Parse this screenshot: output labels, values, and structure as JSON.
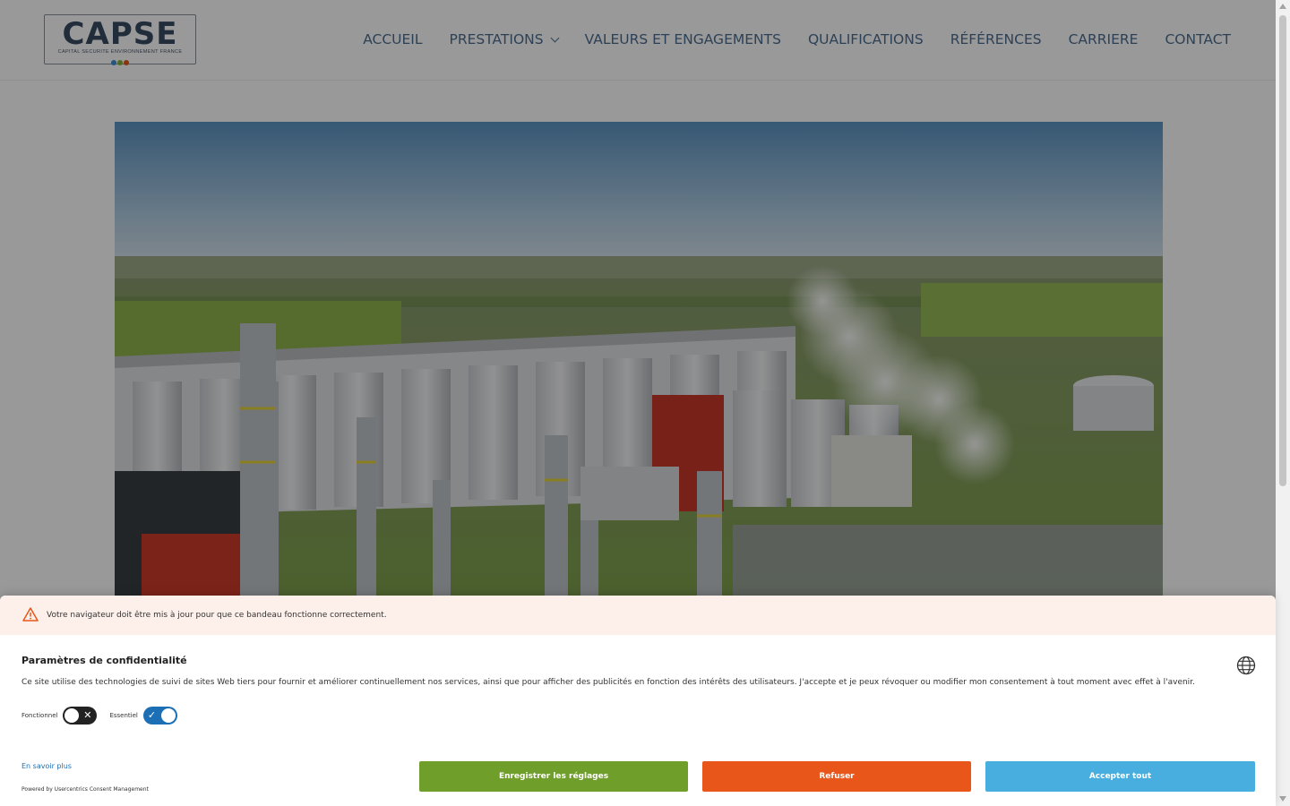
{
  "header": {
    "logo": {
      "wordmark": "CAPSE",
      "tagline": "CAPITAL SECURITE ENVIRONNEMENT FRANCE",
      "dot_colors": [
        "#3b8fd4",
        "#7fb539",
        "#e8561a"
      ]
    },
    "nav": [
      {
        "label": "ACCUEIL",
        "has_dropdown": false
      },
      {
        "label": "PRESTATIONS",
        "has_dropdown": true
      },
      {
        "label": "VALEURS ET ENGAGEMENTS",
        "has_dropdown": false
      },
      {
        "label": "QUALIFICATIONS",
        "has_dropdown": false
      },
      {
        "label": "RÉFÉRENCES",
        "has_dropdown": false
      },
      {
        "label": "CARRIERE",
        "has_dropdown": false
      },
      {
        "label": "CONTACT",
        "has_dropdown": false
      }
    ]
  },
  "hero": {
    "image_subject": "aerial view of industrial plant with grain silos, distillation columns and steam plumes over farmland"
  },
  "consent": {
    "warning": {
      "icon": "warning-triangle-icon",
      "text": "Votre navigateur doit être mis à jour pour que ce bandeau fonctionne correctement."
    },
    "title": "Paramètres de confidentialité",
    "language_icon": "globe-icon",
    "description": "Ce site utilise des technologies de suivi de sites Web tiers pour fournir et améliorer continuellement nos services, ainsi que pour afficher des publicités en fonction des intérêts des utilisateurs. J'accepte et je peux révoquer ou modifier mon consentement à tout moment avec effet à l'avenir.",
    "toggles": [
      {
        "label": "Fonctionnel",
        "state": "off"
      },
      {
        "label": "Essentiel",
        "state": "on"
      }
    ],
    "learn_more": "En savoir plus",
    "powered_by": "Powered by Usercentrics Consent Management",
    "buttons": {
      "save": "Enregistrer les réglages",
      "refuse": "Refuser",
      "accept": "Accepter tout"
    },
    "colors": {
      "save": "#6f9e2a",
      "refuse": "#e8561a",
      "accept": "#48aedf",
      "warning_bg": "#fdf0ea",
      "toggle_on": "#1c6fb5"
    }
  }
}
